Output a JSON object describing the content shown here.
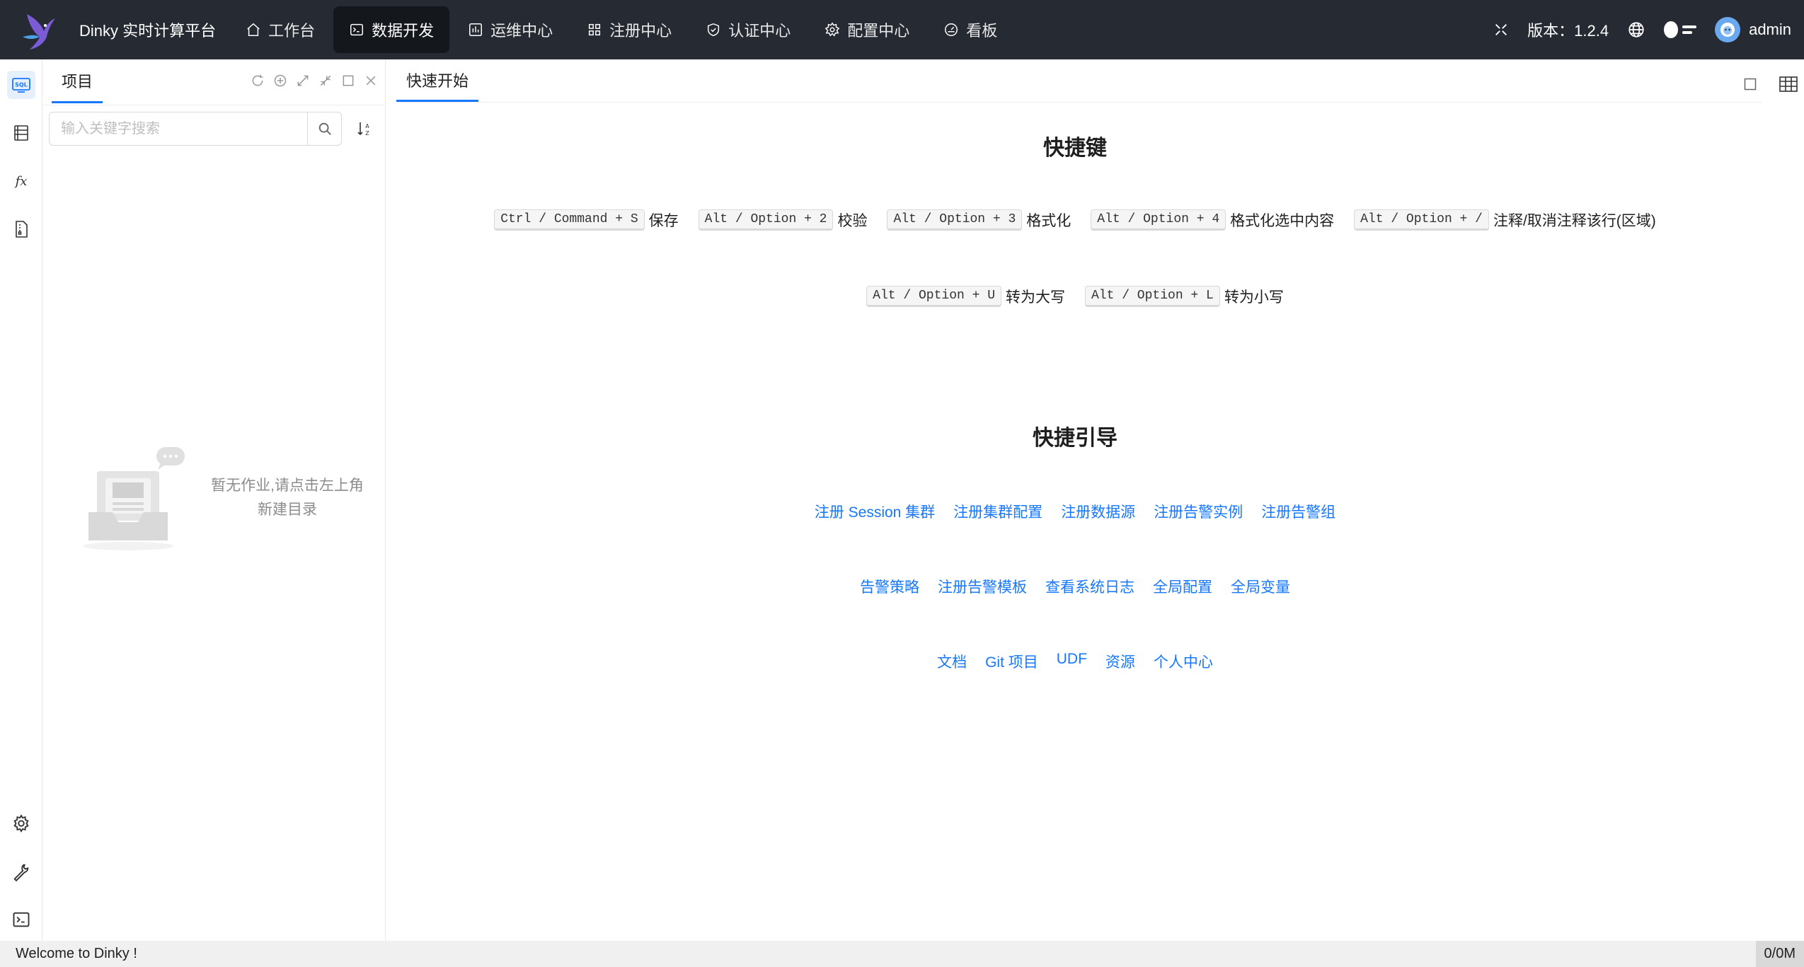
{
  "app": {
    "title": "Dinky 实时计算平台"
  },
  "nav": [
    {
      "label": "工作台",
      "icon": "home-icon"
    },
    {
      "label": "数据开发",
      "icon": "terminal-icon",
      "active": true
    },
    {
      "label": "运维中心",
      "icon": "monitor-icon"
    },
    {
      "label": "注册中心",
      "icon": "grid-icon"
    },
    {
      "label": "认证中心",
      "icon": "shield-icon"
    },
    {
      "label": "配置中心",
      "icon": "gear-icon"
    },
    {
      "label": "看板",
      "icon": "dashboard-icon"
    }
  ],
  "header": {
    "version": "版本：1.2.4",
    "user": "admin"
  },
  "panel": {
    "tab": "项目",
    "search_placeholder": "输入关键字搜索",
    "empty_line1": "暂无作业,请点击左上角",
    "empty_line2": "新建目录"
  },
  "main": {
    "tab": "快速开始",
    "shortcuts_title": "快捷键",
    "shortcuts_row1": [
      {
        "key": "Ctrl / Command + S",
        "label": "保存"
      },
      {
        "key": "Alt / Option + 2",
        "label": "校验"
      },
      {
        "key": "Alt / Option + 3",
        "label": "格式化"
      },
      {
        "key": "Alt / Option + 4",
        "label": "格式化选中内容"
      },
      {
        "key": "Alt / Option + /",
        "label": "注释/取消注释该行(区域)"
      }
    ],
    "shortcuts_row2": [
      {
        "key": "Alt / Option + U",
        "label": "转为大写"
      },
      {
        "key": "Alt / Option + L",
        "label": "转为小写"
      }
    ],
    "guide_title": "快捷引导",
    "guide_row1": [
      "注册 Session 集群",
      "注册集群配置",
      "注册数据源",
      "注册告警实例",
      "注册告警组"
    ],
    "guide_row2": [
      "告警策略",
      "注册告警模板",
      "查看系统日志",
      "全局配置",
      "全局变量"
    ],
    "guide_row3": [
      "文档",
      "Git 项目",
      "UDF",
      "资源",
      "个人中心"
    ]
  },
  "footer": {
    "left": "Welcome to Dinky !",
    "right": "0/0M"
  },
  "colors": {
    "header_bg": "#262a32",
    "accent": "#1677ff"
  }
}
